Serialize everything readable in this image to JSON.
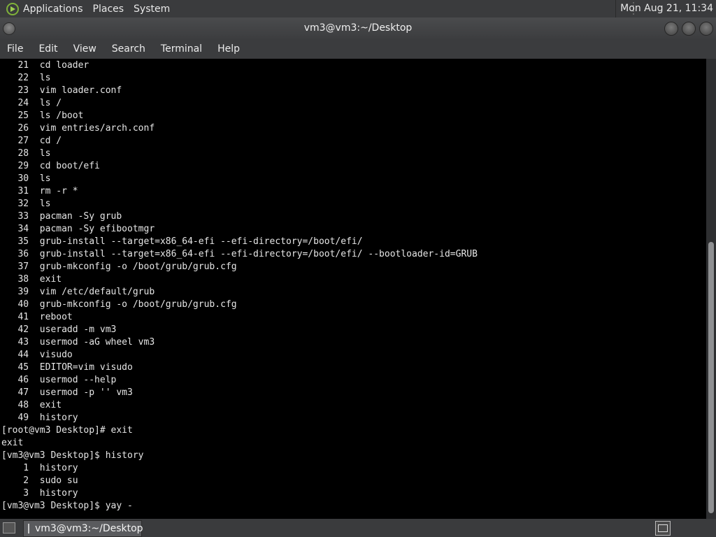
{
  "top_panel": {
    "menus": [
      "Applications",
      "Places",
      "System"
    ],
    "clock": "Mon Aug 21, 11:34"
  },
  "window": {
    "title": "vm3@vm3:~/Desktop",
    "menus": [
      "File",
      "Edit",
      "View",
      "Search",
      "Terminal",
      "Help"
    ]
  },
  "terminal": {
    "lines": [
      "   21  cd loader",
      "   22  ls",
      "   23  vim loader.conf",
      "   24  ls /",
      "   25  ls /boot",
      "   26  vim entries/arch.conf",
      "   27  cd /",
      "   28  ls",
      "   29  cd boot/efi",
      "   30  ls",
      "   31  rm -r *",
      "   32  ls",
      "   33  pacman -Sy grub",
      "   34  pacman -Sy efibootmgr",
      "   35  grub-install --target=x86_64-efi --efi-directory=/boot/efi/",
      "   36  grub-install --target=x86_64-efi --efi-directory=/boot/efi/ --bootloader-id=GRUB",
      "   37  grub-mkconfig -o /boot/grub/grub.cfg",
      "   38  exit",
      "   39  vim /etc/default/grub",
      "   40  grub-mkconfig -o /boot/grub/grub.cfg",
      "   41  reboot",
      "   42  useradd -m vm3",
      "   43  usermod -aG wheel vm3",
      "   44  visudo",
      "   45  EDITOR=vim visudo",
      "   46  usermod --help",
      "   47  usermod -p '' vm3",
      "   48  exit",
      "   49  history",
      "[root@vm3 Desktop]# exit",
      "exit",
      "[vm3@vm3 Desktop]$ history",
      "    1  history",
      "    2  sudo su",
      "    3  history",
      "[vm3@vm3 Desktop]$ yay -"
    ]
  },
  "taskbar": {
    "task_label": "vm3@vm3:~/Desktop"
  }
}
